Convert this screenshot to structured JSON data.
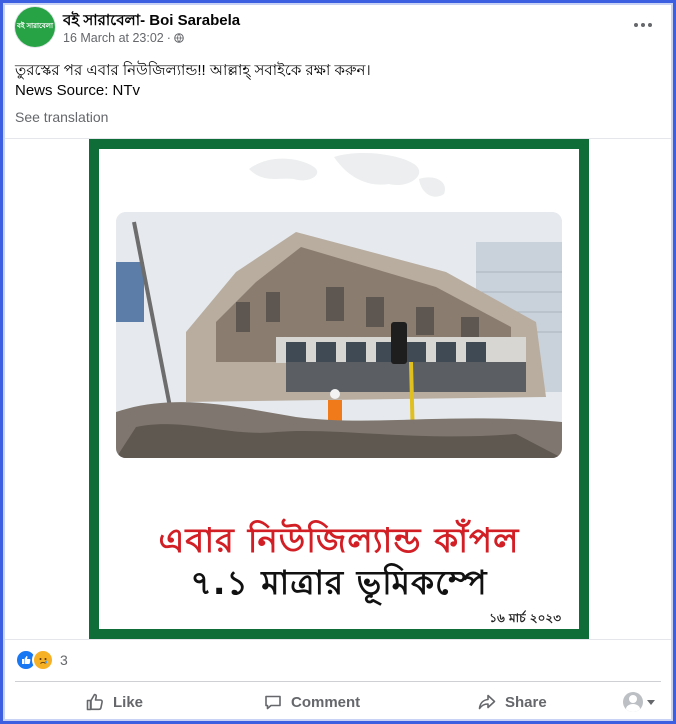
{
  "header": {
    "avatar_text": "বই সারাবেলা",
    "page_name": "বই সারাবেলা- Boi Sarabela",
    "timestamp": "16 March at 23:02",
    "separator": "·"
  },
  "post": {
    "line1": "তুরস্কের পর এবার নিউজিল্যান্ড!! আল্লাহ্ সবাইকে রক্ষা করুন।",
    "line2": "News Source: NTv",
    "see_translation": "See translation"
  },
  "image": {
    "headline": "এবার নিউজিল্যান্ড কাঁপল",
    "subheadline": "৭.১ মাত্রার ভূমিকম্পে",
    "date": "১৬ মার্চ ২০২৩",
    "colors": {
      "border": "#0f6e37",
      "headline": "#d21f26"
    }
  },
  "reactions": {
    "types": [
      "like",
      "sad"
    ],
    "count": "3"
  },
  "actions": {
    "like": "Like",
    "comment": "Comment",
    "share": "Share"
  },
  "icons": [
    "globe-icon",
    "more-icon",
    "like-icon",
    "comment-icon",
    "share-icon",
    "audience-icon",
    "caret-down-icon"
  ]
}
